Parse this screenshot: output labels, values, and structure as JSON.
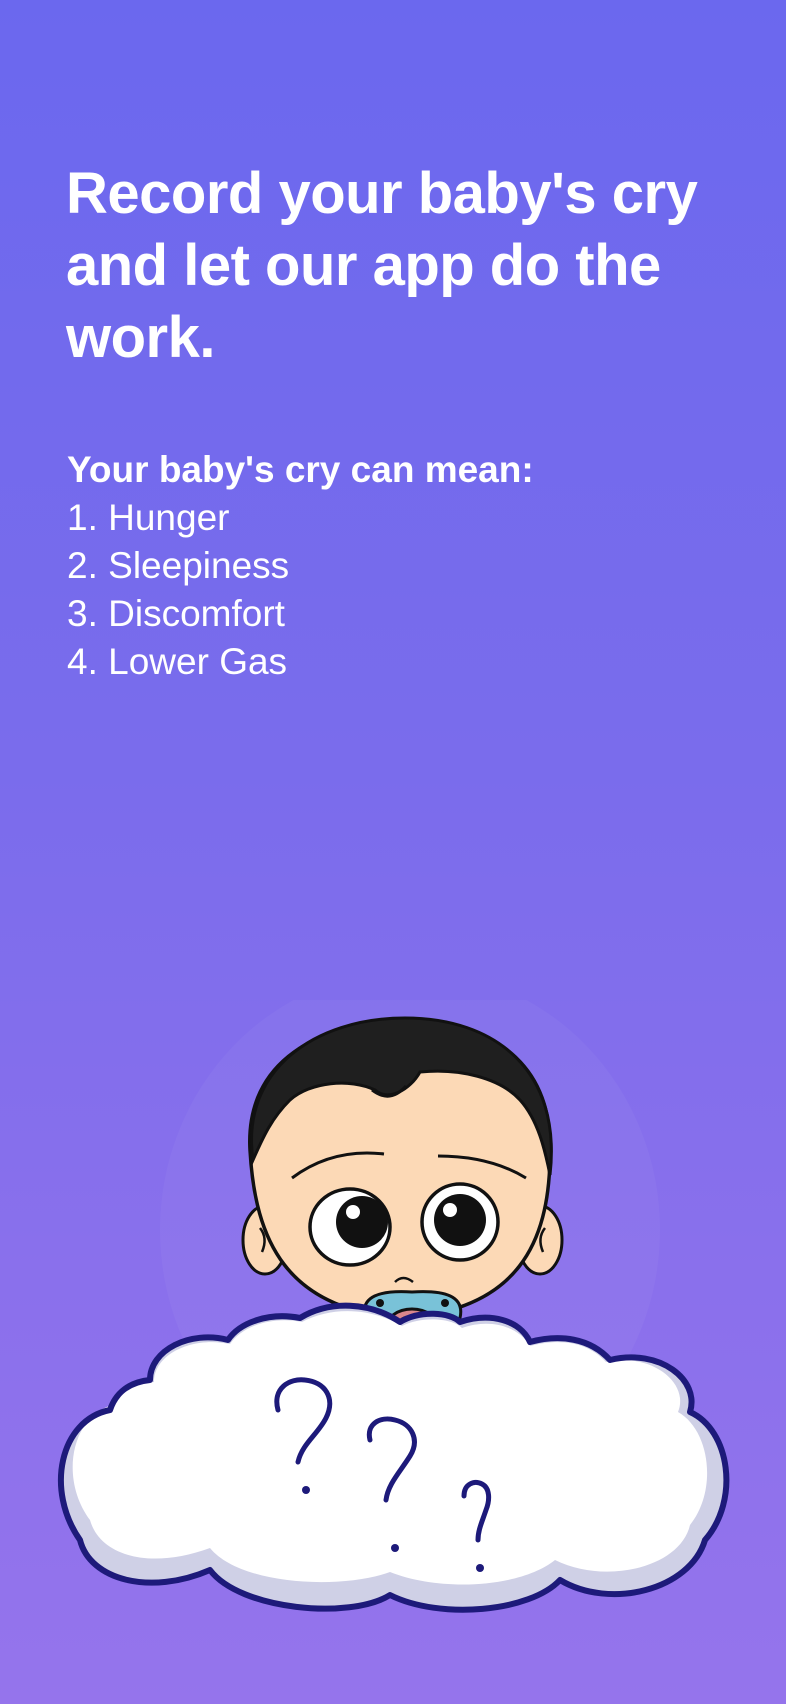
{
  "onboarding": {
    "headline": "Record your baby's cry and let our app do the work.",
    "meanings_title": "Your baby's cry can mean:",
    "meanings": [
      {
        "label": "1. Hunger"
      },
      {
        "label": "2. Sleepiness"
      },
      {
        "label": "3. Discomfort"
      },
      {
        "label": "4. Lower Gas"
      }
    ],
    "illustration": {
      "subject": "baby-with-pacifier",
      "cloud_text": "???"
    }
  },
  "colors": {
    "background_top": "#6b68ee",
    "background_bottom": "#9574ec",
    "text": "#ffffff",
    "hair": "#1f1f1f",
    "skin": "#fcd9b6",
    "pacifier": "#79c2d8",
    "pacifier_ring": "#d9878c",
    "cloud_fill": "#ffffff",
    "cloud_shadow": "#cfd0e6",
    "cloud_outline": "#1d1a7a"
  }
}
